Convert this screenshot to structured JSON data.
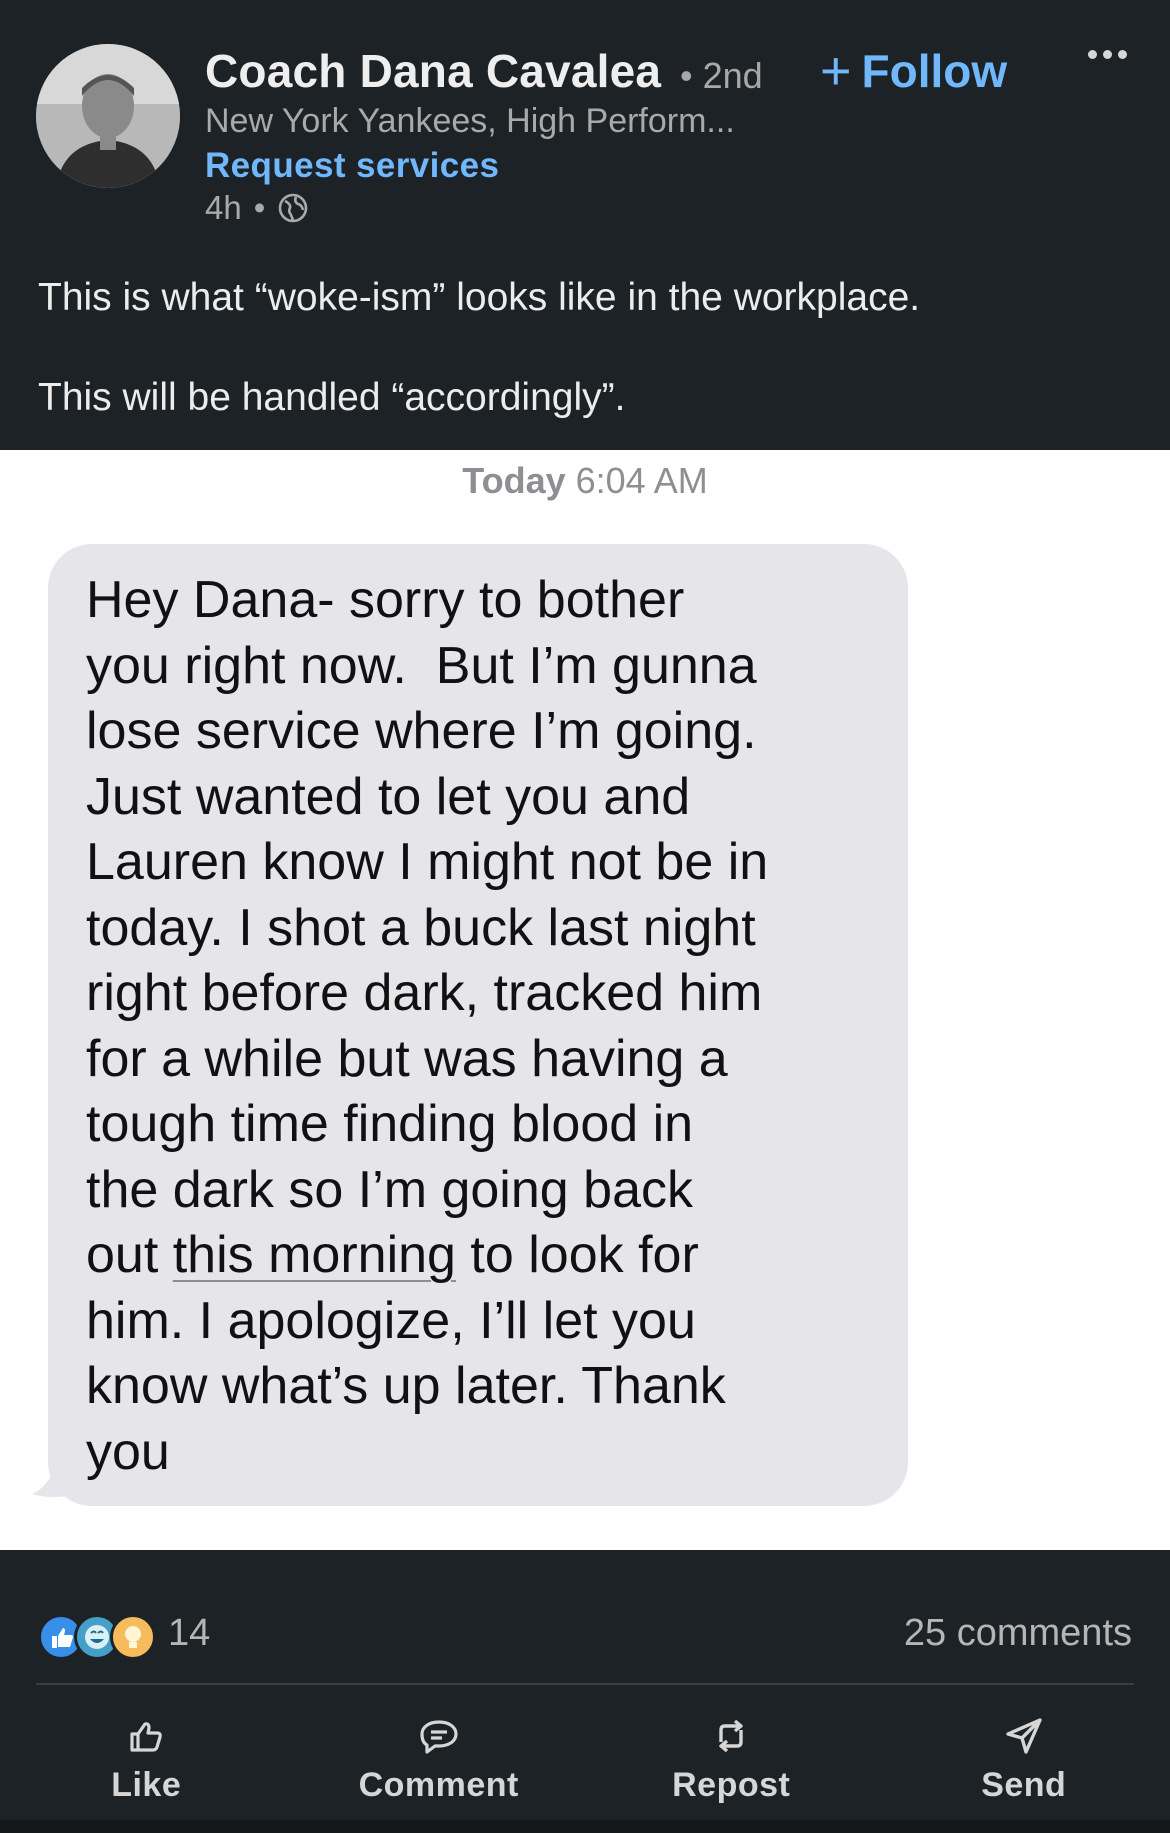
{
  "post": {
    "author_name": "Coach Dana Cavalea",
    "degree": "• 2nd",
    "follow_label": "Follow",
    "headline": "New York Yankees, High Perform...",
    "request_services": "Request services",
    "time_ago": "4h",
    "dot": "•",
    "text_line1": "This is what “woke-ism” looks like in the workplace.",
    "text_line2": "This will be handled “accordingly”."
  },
  "message": {
    "day": "Today",
    "time": "6:04 AM",
    "lines": [
      "Hey Dana- sorry to bother",
      "you right now.  But I’m gunna",
      "lose service where I’m going.",
      "Just wanted to let you and",
      "Lauren know I might not be in",
      "today. I shot a buck last night",
      "right before dark, tracked him",
      "for a while but was having a",
      "tough time finding blood in",
      "the dark so I’m going back"
    ],
    "line11_pre": "out ",
    "line11_underlined": "this morning",
    "line11_post": " to look for",
    "lines_end": [
      "him. I apologize, I’ll let you",
      "know what’s up later. Thank",
      "you"
    ]
  },
  "footer": {
    "reaction_count": "14",
    "comments": "25 comments",
    "actions": {
      "like": "Like",
      "comment": "Comment",
      "repost": "Repost",
      "send": "Send"
    }
  },
  "icons": [
    "globe-icon",
    "plus-icon",
    "more-icon",
    "like-icon",
    "comment-icon",
    "repost-icon",
    "send-icon"
  ],
  "colors": {
    "background": "#1d2226",
    "link": "#71b7fb",
    "bubble": "#e5e5ea"
  }
}
